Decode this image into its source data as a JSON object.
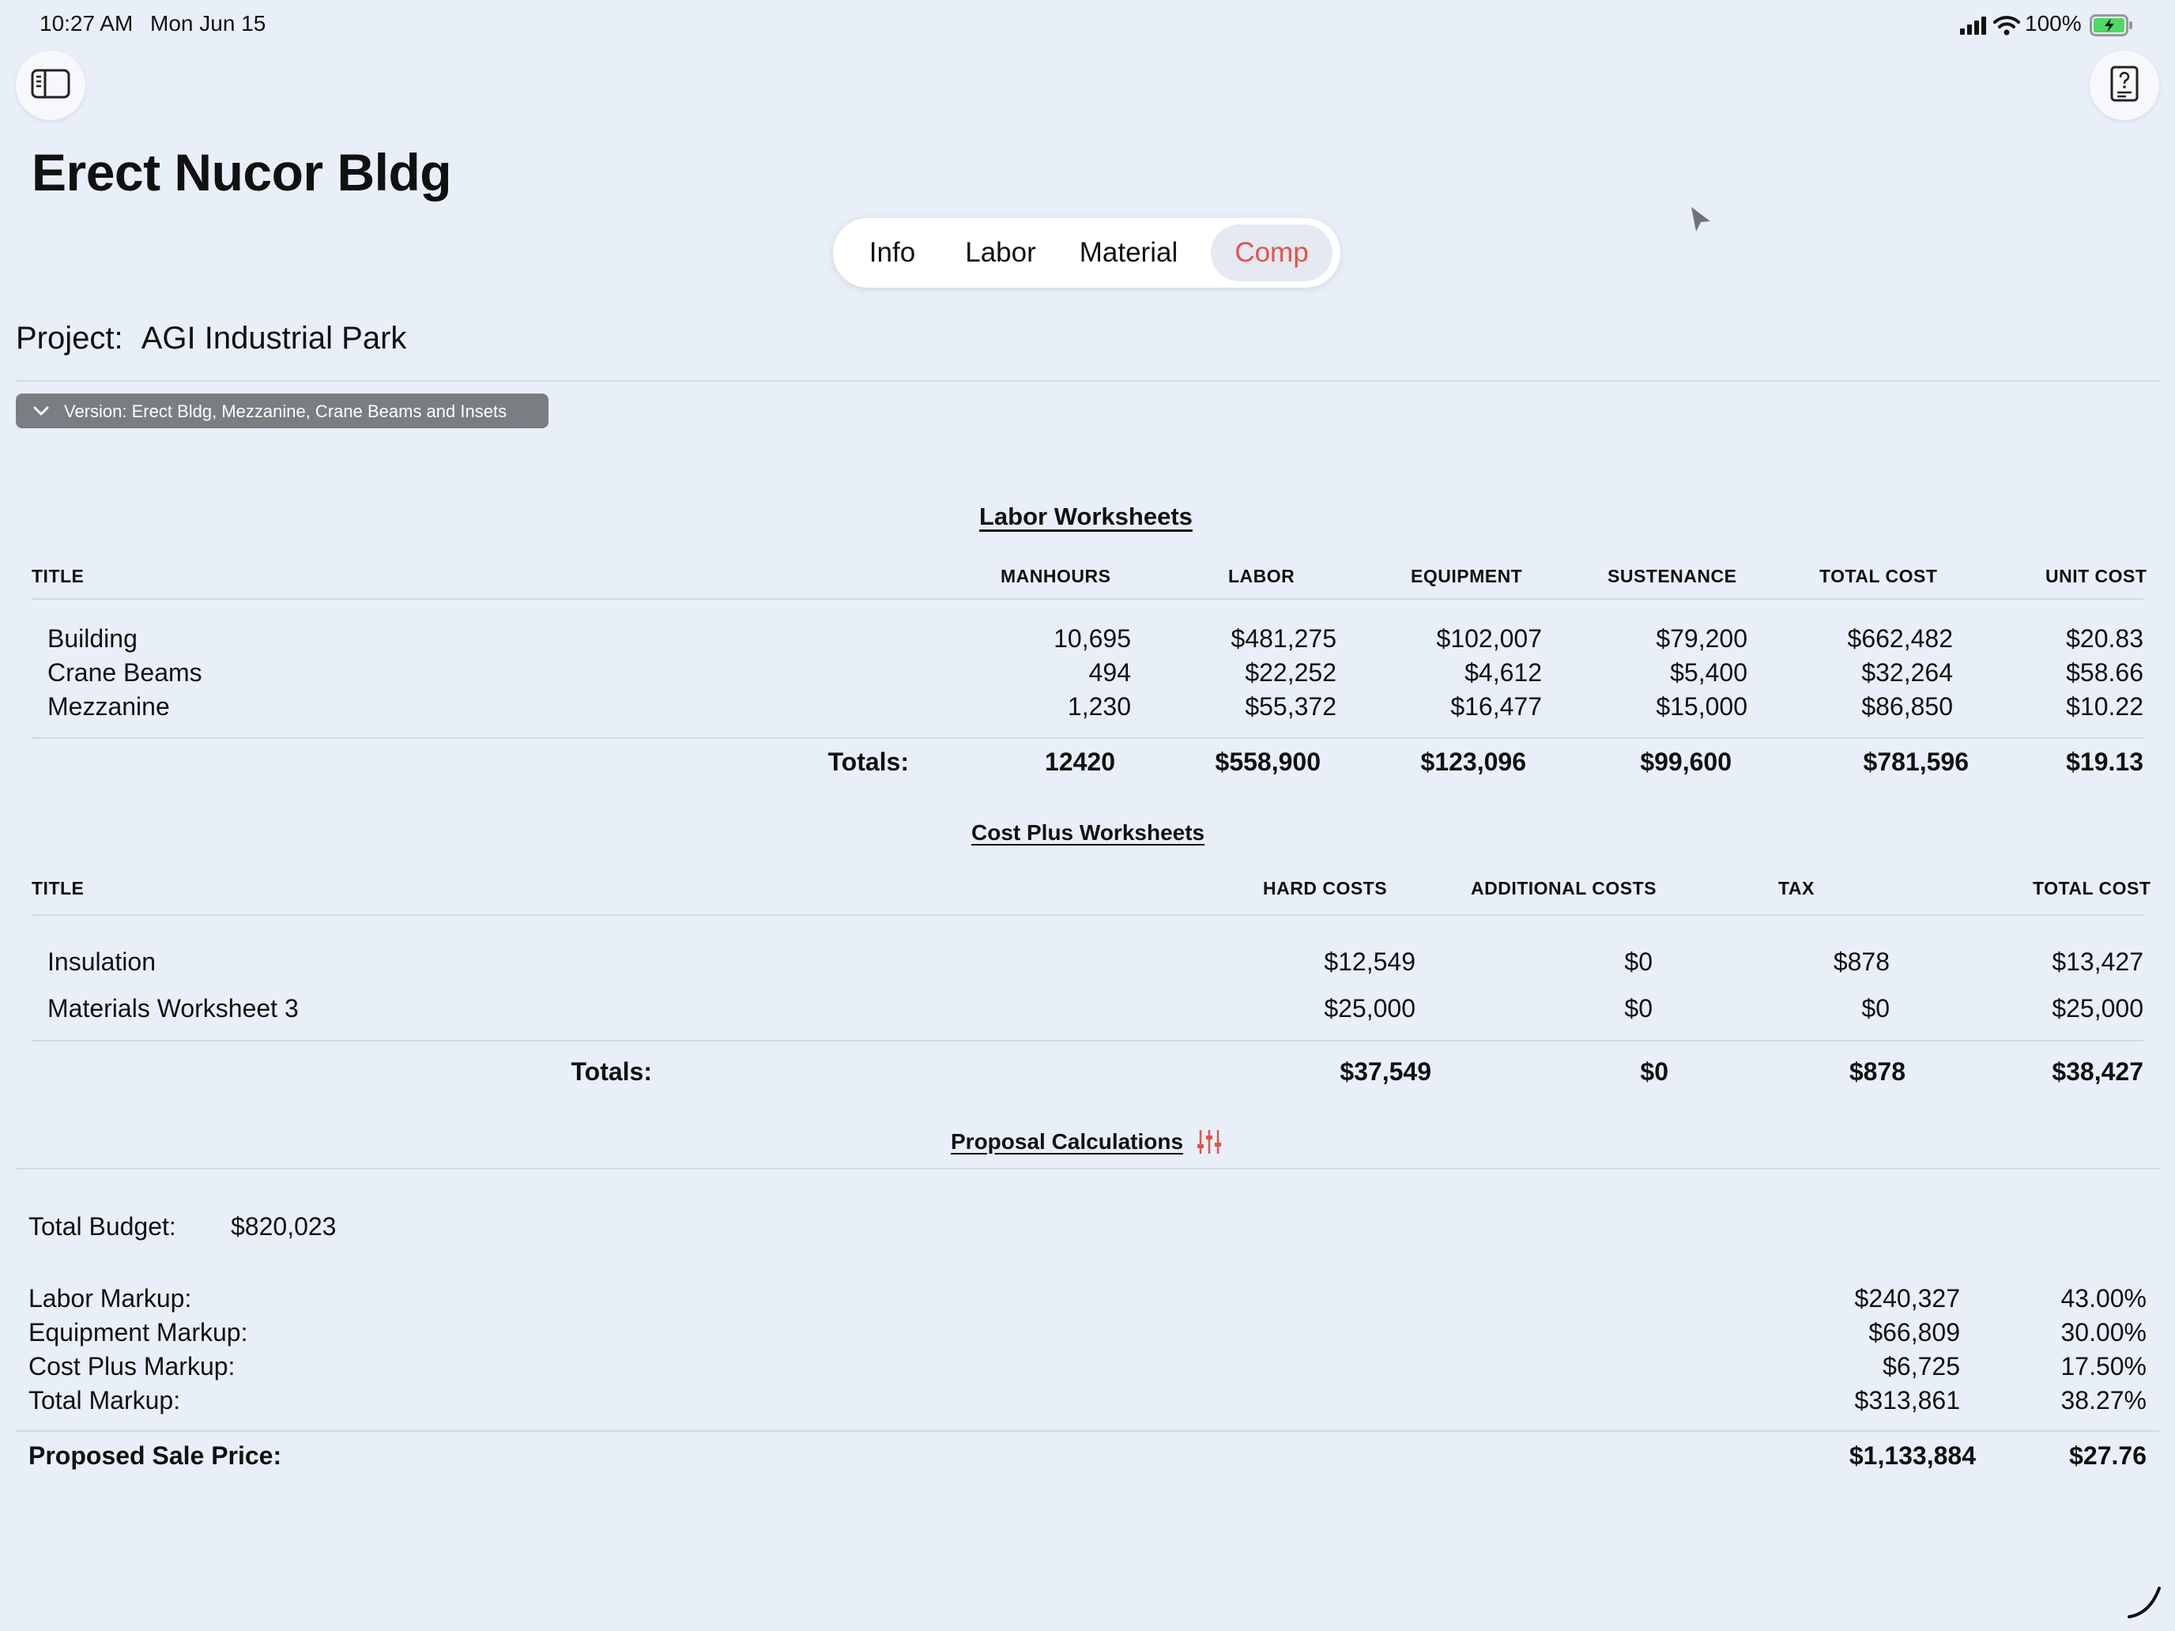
{
  "status_bar": {
    "time": "10:27 AM",
    "date": "Mon Jun 15",
    "battery": "100%"
  },
  "toolbar": {
    "sidebar_icon": "sidebar-icon",
    "help_icon": "help-document-icon"
  },
  "page_title": "Erect Nucor Bldg",
  "tabs": [
    {
      "label": "Info",
      "active": false
    },
    {
      "label": "Labor",
      "active": false
    },
    {
      "label": "Material",
      "active": false
    },
    {
      "label": "Comp",
      "active": true
    }
  ],
  "project": {
    "label": "Project:",
    "value": "AGI Industrial Park"
  },
  "version": {
    "label": "Version: Erect Bldg, Mezzanine, Crane Beams and Insets"
  },
  "labor_worksheets": {
    "title": "Labor Worksheets",
    "headers": [
      "TITLE",
      "MANHOURS",
      "LABOR",
      "EQUIPMENT",
      "SUSTENANCE",
      "TOTAL COST",
      "UNIT COST"
    ],
    "rows": [
      {
        "title": "Building",
        "manhours": "10,695",
        "labor": "$481,275",
        "equipment": "$102,007",
        "sustenance": "$79,200",
        "total_cost": "$662,482",
        "unit_cost": "$20.83"
      },
      {
        "title": "Crane Beams",
        "manhours": "494",
        "labor": "$22,252",
        "equipment": "$4,612",
        "sustenance": "$5,400",
        "total_cost": "$32,264",
        "unit_cost": "$58.66"
      },
      {
        "title": "Mezzanine",
        "manhours": "1,230",
        "labor": "$55,372",
        "equipment": "$16,477",
        "sustenance": "$15,000",
        "total_cost": "$86,850",
        "unit_cost": "$10.22"
      }
    ],
    "totals": {
      "label": "Totals:",
      "manhours": "12420",
      "labor": "$558,900",
      "equipment": "$123,096",
      "sustenance": "$99,600",
      "total_cost": "$781,596",
      "unit_cost": "$19.13"
    }
  },
  "cost_plus_worksheets": {
    "title": "Cost Plus Worksheets",
    "headers": [
      "TITLE",
      "HARD COSTS",
      "ADDITIONAL COSTS",
      "TAX",
      "TOTAL COST"
    ],
    "rows": [
      {
        "title": "Insulation",
        "hard_costs": "$12,549",
        "additional_costs": "$0",
        "tax": "$878",
        "total_cost": "$13,427"
      },
      {
        "title": "Materials Worksheet 3",
        "hard_costs": "$25,000",
        "additional_costs": "$0",
        "tax": "$0",
        "total_cost": "$25,000"
      }
    ],
    "totals": {
      "label": "Totals:",
      "hard_costs": "$37,549",
      "additional_costs": "$0",
      "tax": "$878",
      "total_cost": "$38,427"
    }
  },
  "proposal": {
    "title": "Proposal Calculations",
    "settings_icon": "sliders-icon",
    "total_budget_label": "Total Budget:",
    "total_budget_value": "$820,023",
    "markups": [
      {
        "label": "Labor Markup:",
        "amount": "$240,327",
        "percent": "43.00%"
      },
      {
        "label": "Equipment Markup:",
        "amount": "$66,809",
        "percent": "30.00%"
      },
      {
        "label": "Cost Plus Markup:",
        "amount": "$6,725",
        "percent": "17.50%"
      },
      {
        "label": "Total Markup:",
        "amount": "$313,861",
        "percent": "38.27%"
      }
    ],
    "sale_price": {
      "label": "Proposed Sale Price:",
      "amount": "$1,133,884",
      "unit": "$27.76"
    }
  },
  "colors": {
    "background": "#e9eff8",
    "accent": "#e0534a",
    "pill": "#7a7d82",
    "battery_green": "#4cd964"
  }
}
